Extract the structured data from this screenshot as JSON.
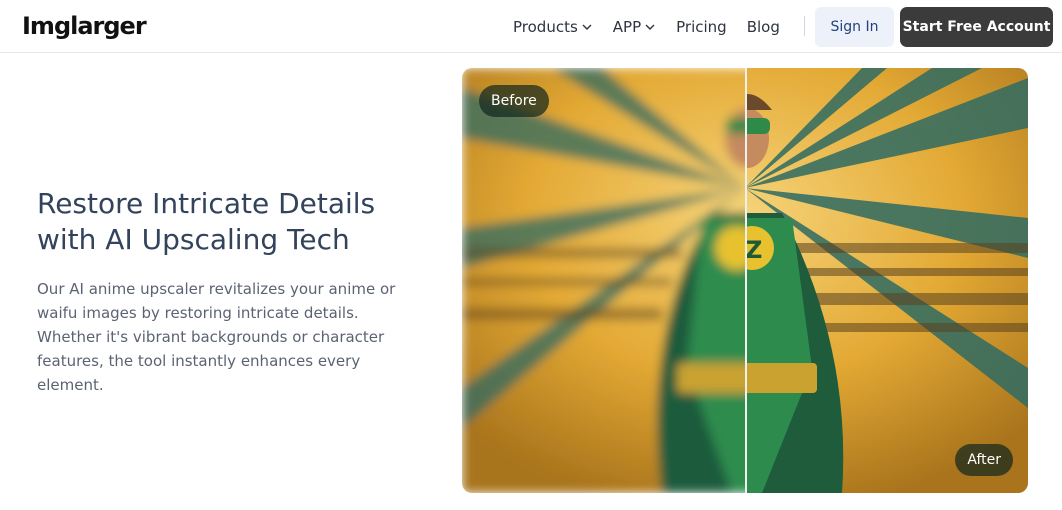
{
  "header": {
    "logo": "Imglarger",
    "nav": [
      {
        "label": "Products",
        "dropdown": true
      },
      {
        "label": "APP",
        "dropdown": true
      },
      {
        "label": "Pricing",
        "dropdown": false
      },
      {
        "label": "Blog",
        "dropdown": false
      }
    ],
    "signin_label": "Sign In",
    "start_label": "Start Free Account"
  },
  "hero": {
    "title": "Restore Intricate Details with AI Upscaling Tech",
    "description": "Our AI anime upscaler revitalizes your anime or waifu images by restoring intricate details. Whether it's vibrant backgrounds or character features, the tool instantly enhances every element."
  },
  "comparison": {
    "before_label": "Before",
    "after_label": "After"
  },
  "colors": {
    "primary_button": "#3b3b3b",
    "secondary_button_bg": "#edf1fa",
    "heading": "#34435c"
  }
}
